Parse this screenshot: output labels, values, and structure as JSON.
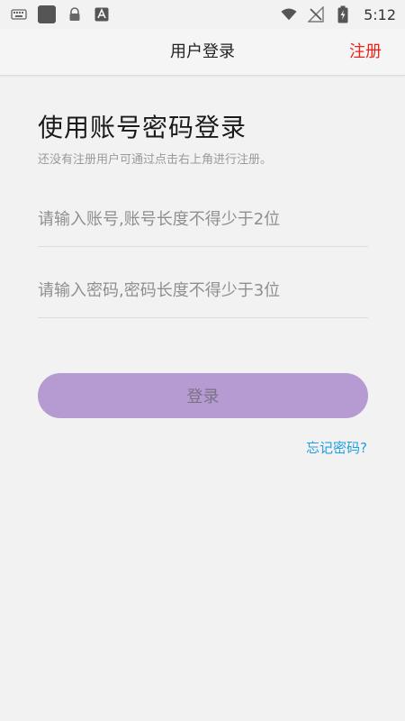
{
  "status_bar": {
    "time": "5:12",
    "icons": [
      "keyboard-icon",
      "app-square-icon",
      "lock-icon",
      "font-icon",
      "wifi-icon",
      "no-signal-icon",
      "battery-charging-icon"
    ]
  },
  "header": {
    "title": "用户登录",
    "register_label": "注册"
  },
  "main": {
    "headline": "使用账号密码登录",
    "subtitle": "还没有注册用户可通过点击右上角进行注册。",
    "account_input": {
      "value": "",
      "placeholder": "请输入账号,账号长度不得少于2位"
    },
    "password_input": {
      "value": "",
      "placeholder": "请输入密码,密码长度不得少于3位"
    },
    "login_label": "登录",
    "forgot_label": "忘记密码?"
  },
  "colors": {
    "accent_red": "#e8241d",
    "button_purple": "#b69bd3",
    "link_blue": "#1ea0e0"
  }
}
